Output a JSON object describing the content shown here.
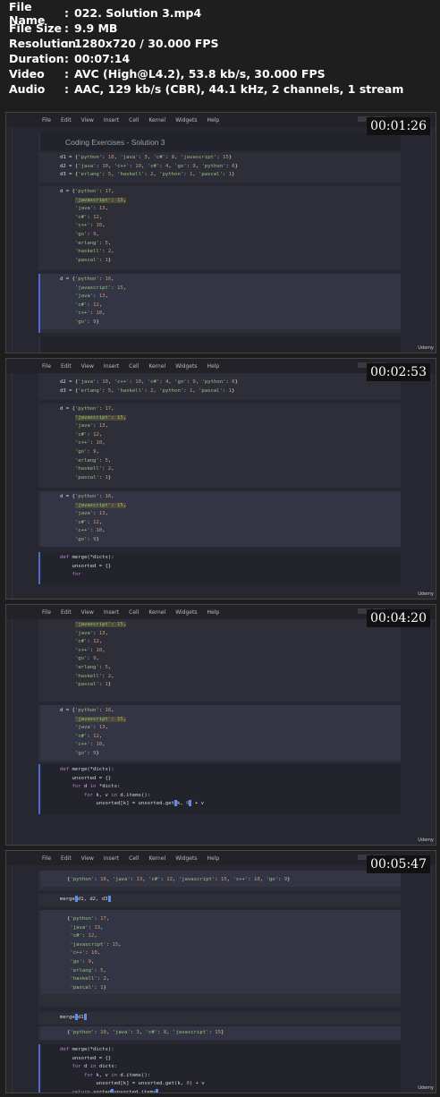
{
  "info": [
    {
      "key": "File Name",
      "value": "022. Solution 3.mp4"
    },
    {
      "key": "File Size",
      "value": "9.9 MB"
    },
    {
      "key": "Resolution",
      "value": "1280x720 / 30.000 FPS"
    },
    {
      "key": "Duration",
      "value": "00:07:14"
    },
    {
      "key": "Video",
      "value": "AVC (High@L4.2), 53.8 kb/s, 30.000 FPS"
    },
    {
      "key": "Audio",
      "value": "AAC, 129 kb/s (CBR), 44.1 kHz, 2 channels, 1 stream"
    }
  ],
  "menu": [
    "File",
    "Edit",
    "View",
    "Insert",
    "Cell",
    "Kernel",
    "Widgets",
    "Help"
  ],
  "brand": "Udemy",
  "frames": [
    {
      "timestamp": "00:01:26",
      "heading": "Coding Exercises - Solution 3"
    },
    {
      "timestamp": "00:02:53"
    },
    {
      "timestamp": "00:04:20"
    },
    {
      "timestamp": "00:05:47"
    }
  ]
}
